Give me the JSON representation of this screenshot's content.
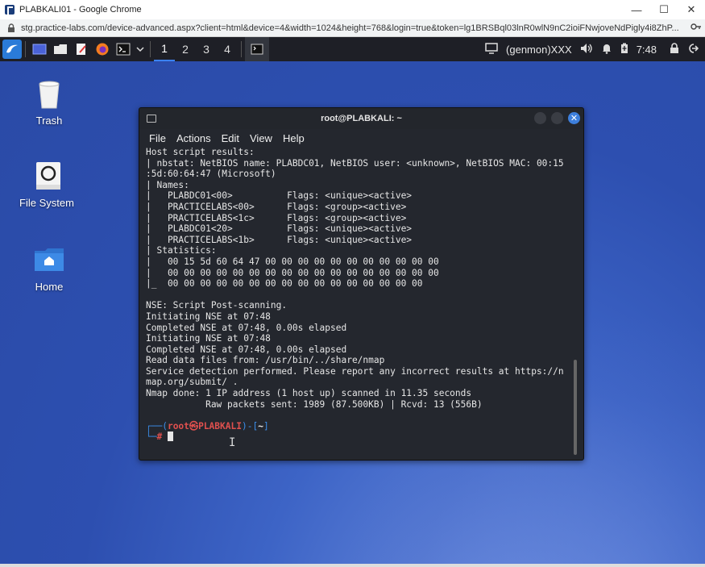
{
  "browser": {
    "window_title": "PLABKALI01 - Google Chrome",
    "url": "stg.practice-labs.com/device-advanced.aspx?client=html&device=4&width=1024&height=768&login=true&token=lg1BRSBql03lnR0wlN9nC2ioiFNwjoveNdPigly4i8ZhP..."
  },
  "taskbar": {
    "workspaces": [
      "1",
      "2",
      "3",
      "4"
    ],
    "active_workspace": "1",
    "genmon": "(genmon)XXX",
    "clock": "7:48"
  },
  "desktop_icons": [
    {
      "label": "Trash",
      "icon": "trash-icon"
    },
    {
      "label": "File System",
      "icon": "drive-icon"
    },
    {
      "label": "Home",
      "icon": "home-folder-icon"
    }
  ],
  "terminal": {
    "title": "root@PLABKALI: ~",
    "menu": [
      "File",
      "Actions",
      "Edit",
      "View",
      "Help"
    ],
    "lines": [
      "Host script results:",
      "| nbstat: NetBIOS name: PLABDC01, NetBIOS user: <unknown>, NetBIOS MAC: 00:15",
      ":5d:60:64:47 (Microsoft)",
      "| Names:",
      "|   PLABDC01<00>          Flags: <unique><active>",
      "|   PRACTICELABS<00>      Flags: <group><active>",
      "|   PRACTICELABS<1c>      Flags: <group><active>",
      "|   PLABDC01<20>          Flags: <unique><active>",
      "|   PRACTICELABS<1b>      Flags: <unique><active>",
      "| Statistics:",
      "|   00 15 5d 60 64 47 00 00 00 00 00 00 00 00 00 00 00",
      "|   00 00 00 00 00 00 00 00 00 00 00 00 00 00 00 00 00",
      "|_  00 00 00 00 00 00 00 00 00 00 00 00 00 00 00 00",
      "",
      "NSE: Script Post-scanning.",
      "Initiating NSE at 07:48",
      "Completed NSE at 07:48, 0.00s elapsed",
      "Initiating NSE at 07:48",
      "Completed NSE at 07:48, 0.00s elapsed",
      "Read data files from: /usr/bin/../share/nmap",
      "Service detection performed. Please report any incorrect results at https://n",
      "map.org/submit/ .",
      "Nmap done: 1 IP address (1 host up) scanned in 11.35 seconds",
      "           Raw packets sent: 1989 (87.500KB) | Rcvd: 13 (556B)",
      ""
    ],
    "prompt": {
      "line1_prefix": "┌──(",
      "user_host": "root㉿PLABKALI",
      "line1_mid": ")-[",
      "dir": "~",
      "line1_suffix": "]",
      "line2_prefix": "└─",
      "symbol": "#"
    }
  }
}
